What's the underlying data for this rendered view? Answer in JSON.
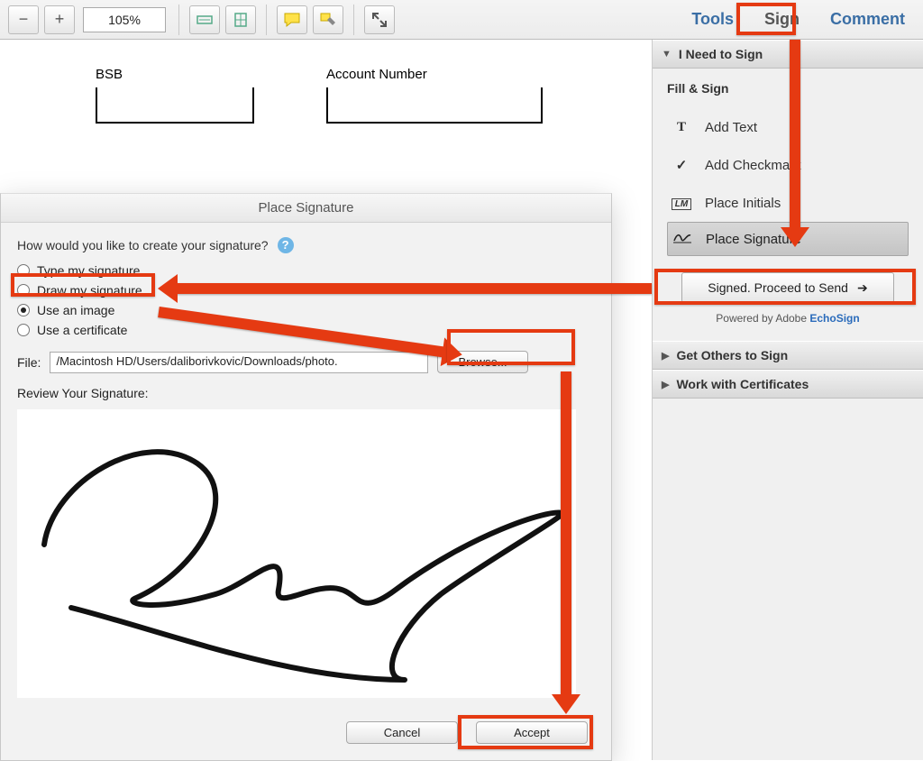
{
  "toolbar": {
    "zoom": "105%"
  },
  "tooltabs": {
    "tools": "Tools",
    "sign": "Sign",
    "comment": "Comment"
  },
  "formhints": {
    "bsb": "BSB",
    "acct": "Account Number"
  },
  "dialog": {
    "title": "Place Signature",
    "prompt": "How would you like to create your signature?",
    "options": {
      "type_sig": "Type my signature",
      "draw_sig": "Draw my signature",
      "use_image": "Use an image",
      "use_cert": "Use a certificate"
    },
    "file_label": "File:",
    "file_value": "/Macintosh HD/Users/daliborivkovic/Downloads/photo.",
    "browse": "Browse...",
    "review": "Review Your Signature:",
    "cancel": "Cancel",
    "accept": "Accept"
  },
  "panel": {
    "need_to_sign": "I Need to Sign",
    "fill_sign": "Fill & Sign",
    "add_text": "Add Text",
    "add_check": "Add Checkmark",
    "place_initials": "Place Initials",
    "place_signature": "Place Signature",
    "signed_proceed": "Signed. Proceed to Send",
    "powered_prefix": "Powered by Adobe ",
    "powered_link": "EchoSign",
    "get_others": "Get Others to Sign",
    "work_certs": "Work with Certificates"
  }
}
